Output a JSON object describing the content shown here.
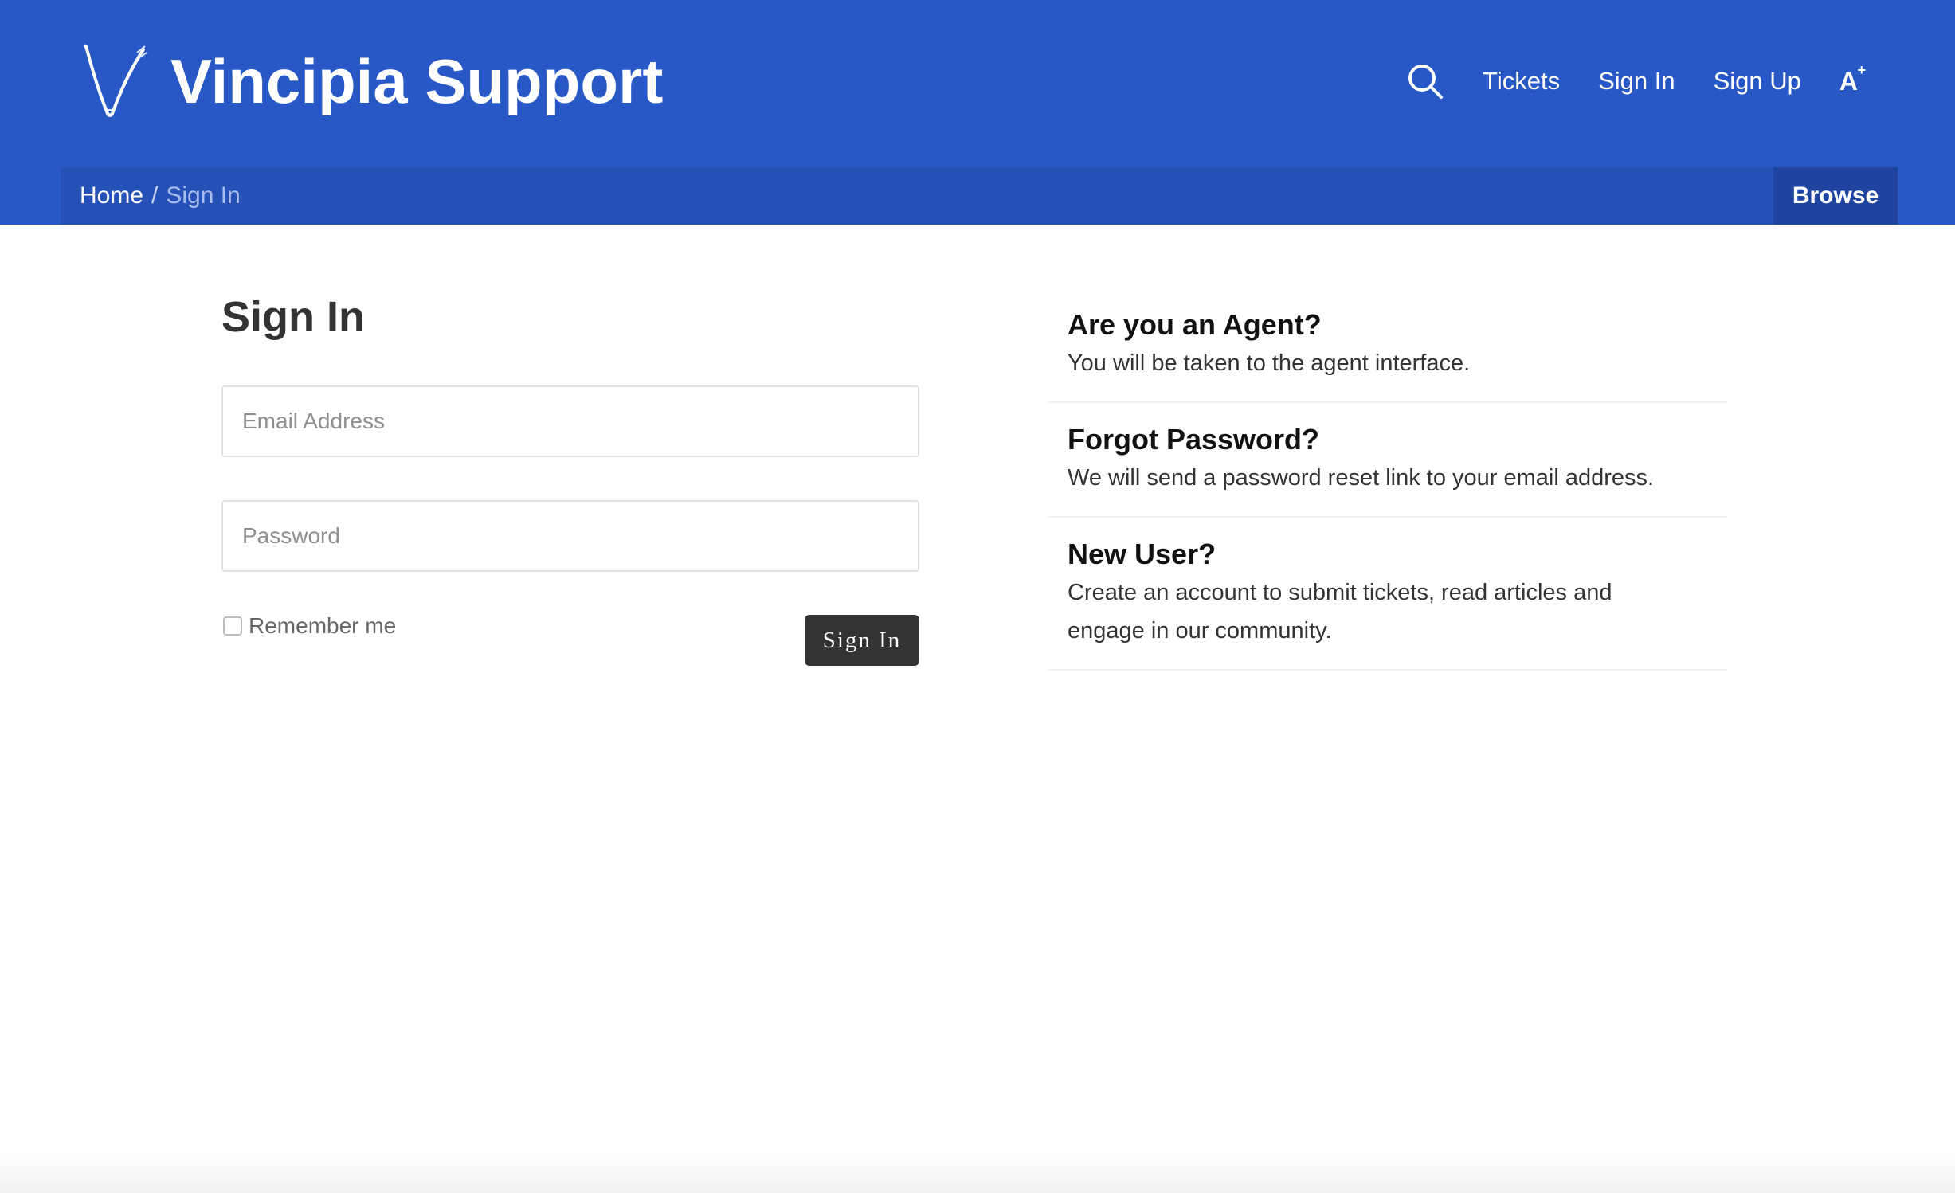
{
  "header": {
    "site_title": "Vincipia Support",
    "nav": {
      "tickets": "Tickets",
      "sign_in": "Sign In",
      "sign_up": "Sign Up",
      "font_size_toggle": "A",
      "font_size_sup": "+"
    },
    "icons": {
      "search": "search-icon",
      "logo": "vincipia-logo-icon"
    },
    "colors": {
      "header_bg": "#2858c6",
      "breadcrumb_bg": "#2550b5",
      "browse_bg": "#1f449f"
    }
  },
  "breadcrumb": {
    "home": "Home",
    "separator": "/",
    "current": "Sign In",
    "browse_label": "Browse"
  },
  "form": {
    "heading": "Sign In",
    "email_placeholder": "Email Address",
    "password_placeholder": "Password",
    "remember_label": "Remember me",
    "submit_label": "Sign In"
  },
  "info": {
    "items": [
      {
        "title": "Are you an Agent?",
        "desc": "You will be taken to the agent interface."
      },
      {
        "title": "Forgot Password?",
        "desc": "We will send a password reset link to your email address."
      },
      {
        "title": "New User?",
        "desc": "Create an account to submit tickets, read articles and engage in our community."
      }
    ]
  }
}
